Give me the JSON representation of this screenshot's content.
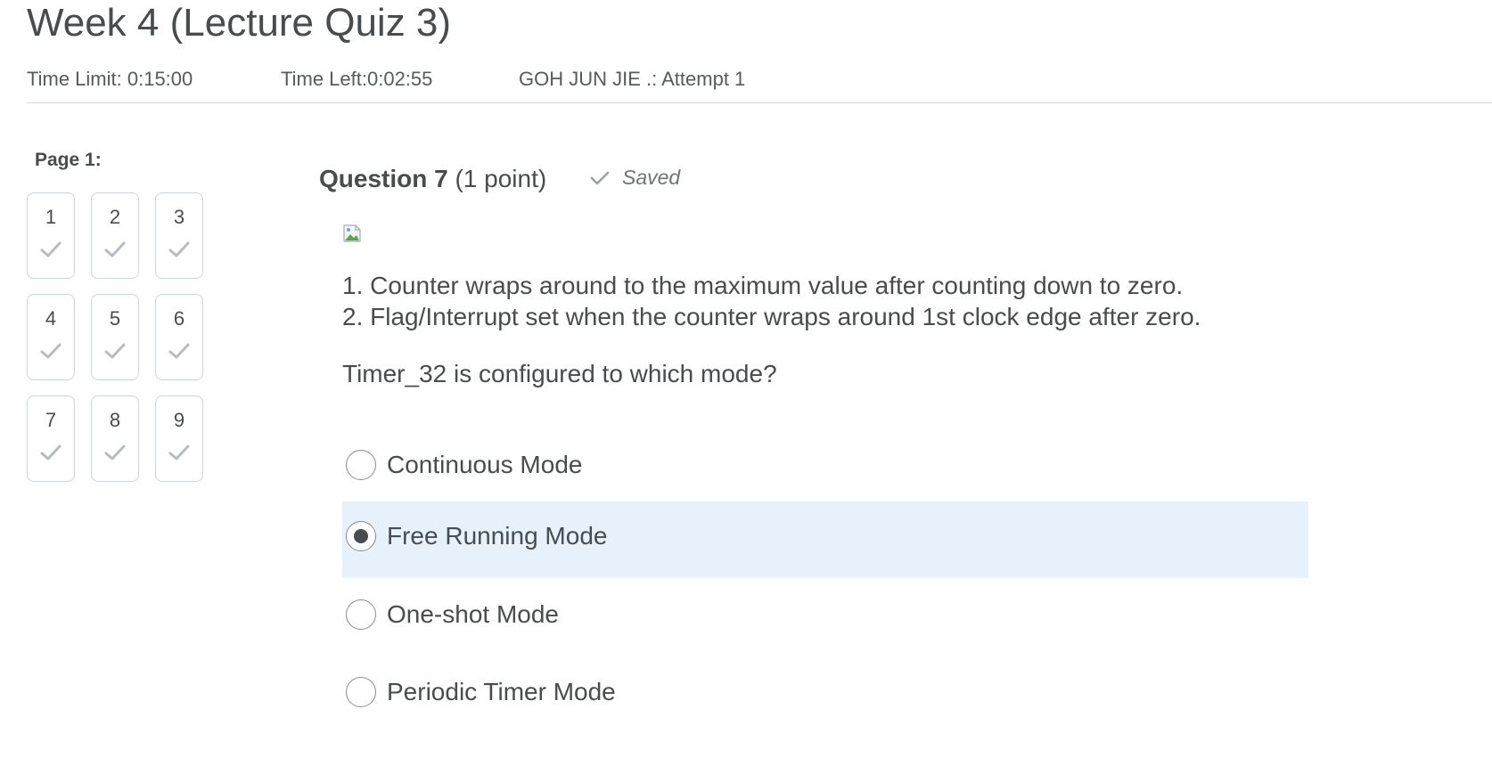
{
  "quiz": {
    "title": "Week 4 (Lecture Quiz 3)",
    "time_limit": "Time Limit: 0:15:00",
    "time_left": "Time Left:0:02:55",
    "attempt": "GOH JUN JIE .: Attempt 1"
  },
  "navigation": {
    "page_label": "Page 1:",
    "questions": [
      {
        "number": "1",
        "answered": true
      },
      {
        "number": "2",
        "answered": true
      },
      {
        "number": "3",
        "answered": true
      },
      {
        "number": "4",
        "answered": true
      },
      {
        "number": "5",
        "answered": true
      },
      {
        "number": "6",
        "answered": true
      },
      {
        "number": "7",
        "answered": true
      },
      {
        "number": "8",
        "answered": true
      },
      {
        "number": "9",
        "answered": true
      }
    ]
  },
  "question": {
    "number_label": "Question 7",
    "points_label": "(1 point)",
    "saved_label": "Saved",
    "lines": [
      "1. Counter wraps around to the maximum value after counting down to zero.",
      "2. Flag/Interrupt set when the counter wraps around 1st clock edge after zero."
    ],
    "prompt": "Timer_32 is configured to which mode?",
    "options": [
      {
        "label": "Continuous Mode",
        "selected": false
      },
      {
        "label": "Free Running Mode",
        "selected": true
      },
      {
        "label": "One-shot Mode",
        "selected": false
      },
      {
        "label": "Periodic Timer Mode",
        "selected": false
      }
    ]
  },
  "colors": {
    "text": "#494c4e",
    "selected_option_bg": "#e6f1fb",
    "check": "#b5bcc2"
  },
  "icons": {
    "saved": "checkmark-icon",
    "answered": "checkmark-icon",
    "image": "broken-image-icon"
  }
}
